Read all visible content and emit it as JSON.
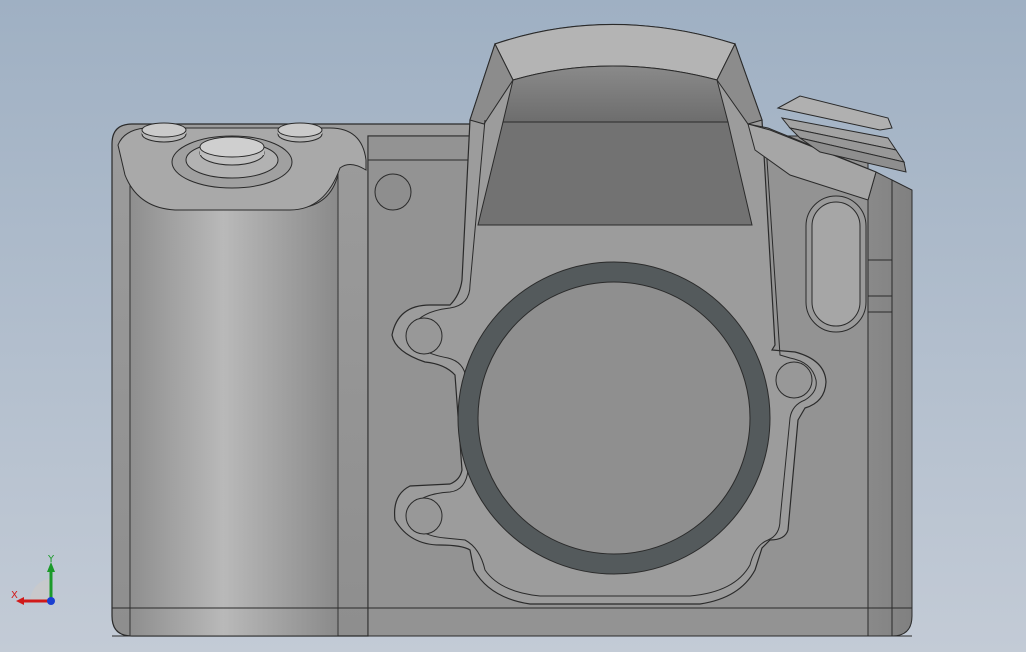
{
  "viewport": {
    "background_top": "#9fb0c3",
    "background_bottom": "#c3cbd6"
  },
  "model": {
    "body_color": "#9a9a9a",
    "body_dark": "#7c7c7c",
    "mount_ring_color": "#545a5c",
    "edge_color": "#2a2a2a"
  },
  "triad": {
    "x_label": "X",
    "y_label": "Y",
    "x_color": "#d11a1a",
    "y_color": "#1b9a2a",
    "z_color": "#1a3fd1"
  }
}
